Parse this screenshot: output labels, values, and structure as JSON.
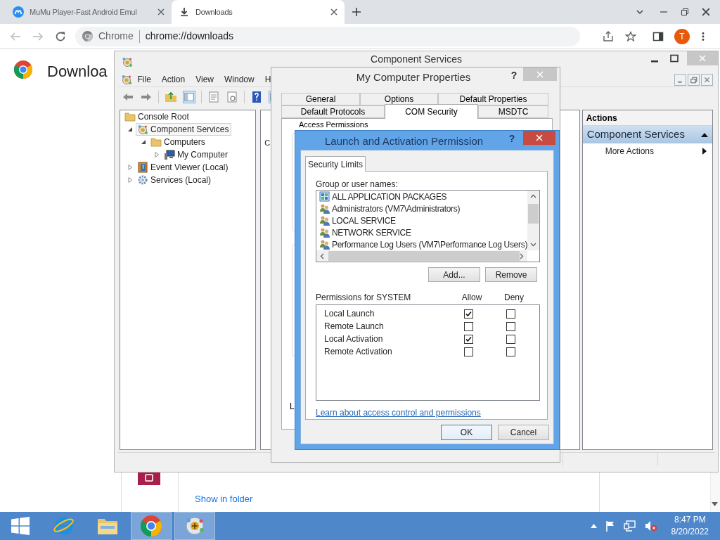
{
  "browser": {
    "tabs": [
      {
        "title": "MuMu Player-Fast Android Emul",
        "kind": "app",
        "selected": false
      },
      {
        "title": "Downloads",
        "kind": "download",
        "selected": true
      }
    ],
    "omnibox": {
      "chip": "Chrome",
      "url": "chrome://downloads"
    },
    "avatar": "T"
  },
  "page": {
    "heading": "Downloa",
    "link": "Show in folder"
  },
  "mmc": {
    "title": "Component Services",
    "menu": [
      "File",
      "Action",
      "View",
      "Window",
      "H"
    ],
    "tree": [
      {
        "label": "Console Root",
        "kind": "folder",
        "selected": false,
        "children": [
          {
            "label": "Component Services",
            "kind": "snapin",
            "selected": true,
            "expanded": true,
            "children": [
              {
                "label": "Computers",
                "kind": "folder",
                "selected": false,
                "expanded": true,
                "children": [
                  {
                    "label": "My Computer",
                    "kind": "computer",
                    "selected": false,
                    "expanded": false
                  }
                ]
              }
            ]
          },
          {
            "label": "Event Viewer (Local)",
            "kind": "event",
            "selected": false,
            "expanded": false
          },
          {
            "label": "Services (Local)",
            "kind": "services",
            "selected": false,
            "expanded": false
          }
        ]
      }
    ],
    "middle_text": "C",
    "actions": {
      "header": "Actions",
      "section": "Component Services",
      "items": [
        "More Actions"
      ]
    }
  },
  "properties": {
    "title": "My Computer Properties",
    "help": "?",
    "tab_rows": [
      [
        {
          "label": "General",
          "selected": false
        },
        {
          "label": "Options",
          "selected": false
        },
        {
          "label": "Default Properties",
          "selected": false
        }
      ],
      [
        {
          "label": "Default Protocols",
          "selected": false
        },
        {
          "label": "COM Security",
          "selected": true
        },
        {
          "label": "MSDTC",
          "selected": false
        }
      ]
    ],
    "group_label": "Access Permissions",
    "fragment": "L"
  },
  "dialog": {
    "title": "Launch and Activation Permission",
    "help": "?",
    "tab": "Security Limits",
    "users_label": "Group or user names:",
    "users": [
      {
        "name": "ALL APPLICATION PACKAGES",
        "kind": "package"
      },
      {
        "name": "Administrators (VM7\\Administrators)",
        "kind": "group"
      },
      {
        "name": "LOCAL SERVICE",
        "kind": "group"
      },
      {
        "name": "NETWORK SERVICE",
        "kind": "group"
      },
      {
        "name": "Performance Log Users (VM7\\Performance Log Users)",
        "kind": "group"
      }
    ],
    "list_buttons": [
      "Add...",
      "Remove"
    ],
    "permissions_label": "Permissions for SYSTEM",
    "columns": [
      "Allow",
      "Deny"
    ],
    "permissions": [
      {
        "name": "Local Launch",
        "allow": true,
        "deny": false
      },
      {
        "name": "Remote Launch",
        "allow": false,
        "deny": false
      },
      {
        "name": "Local Activation",
        "allow": true,
        "deny": false
      },
      {
        "name": "Remote Activation",
        "allow": false,
        "deny": false
      }
    ],
    "link": "Learn about access control and permissions",
    "buttons": [
      {
        "label": "OK",
        "default": true
      },
      {
        "label": "Cancel",
        "default": false
      }
    ]
  },
  "taskbar": {
    "apps": [
      {
        "kind": "ie",
        "active": false
      },
      {
        "kind": "explorer",
        "active": false
      },
      {
        "kind": "chrome",
        "active": true
      },
      {
        "kind": "complus",
        "active": true
      }
    ],
    "time": "8:47 PM",
    "date": "8/20/2022"
  }
}
